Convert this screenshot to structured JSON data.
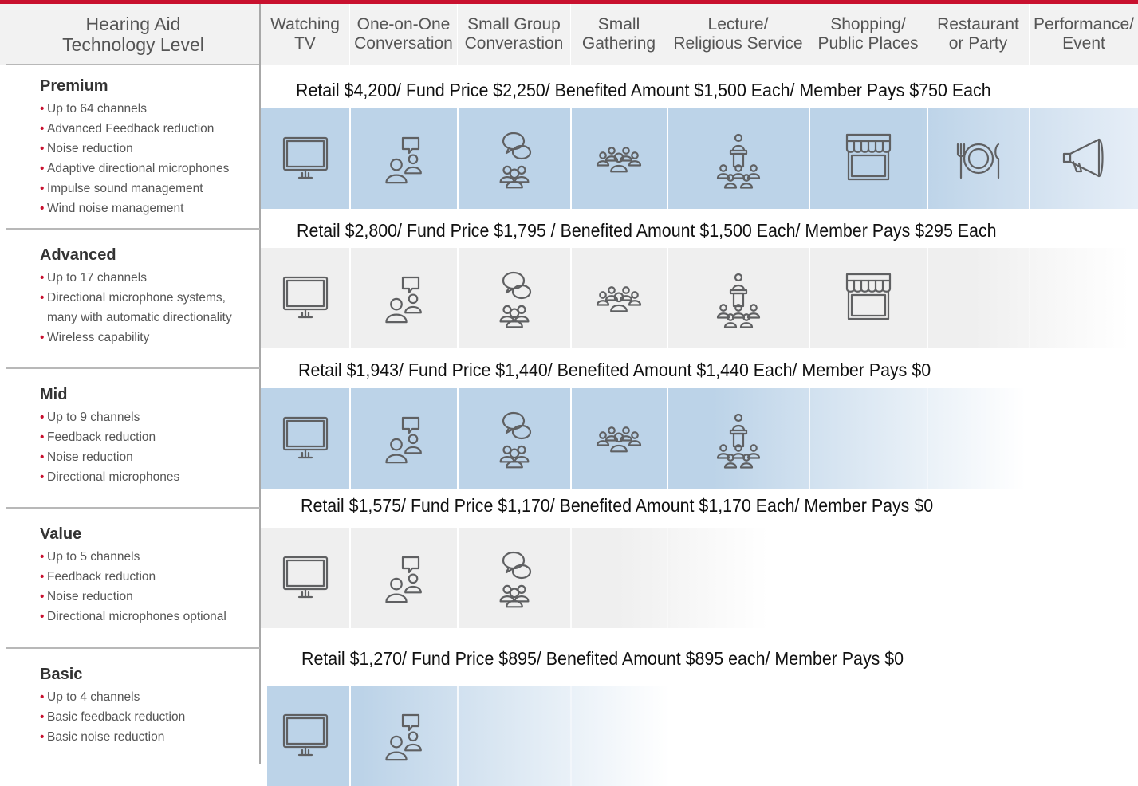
{
  "header": {
    "title": "Hearing Aid\nTechnology Level",
    "columns": [
      {
        "label": "Watching\nTV"
      },
      {
        "label": "One-on-One\nConversation"
      },
      {
        "label": "Small Group\nConverastion"
      },
      {
        "label": "Small\nGathering"
      },
      {
        "label": "Lecture/\nReligious Service"
      },
      {
        "label": "Shopping/\nPublic Places"
      },
      {
        "label": "Restaurant\nor Party"
      },
      {
        "label": "Performance/\nEvent"
      }
    ]
  },
  "column_icons": [
    "tv-icon",
    "conversation-icon",
    "group-chat-icon",
    "crowd-icon",
    "lecture-icon",
    "store-icon",
    "dining-icon",
    "megaphone-icon"
  ],
  "tiers": [
    {
      "name": "Premium",
      "features": [
        "Up to 64 channels",
        "Advanced Feedback reduction",
        "Noise reduction",
        "Adaptive directional microphones",
        "Impulse sound management",
        "Wind noise management"
      ],
      "price": "Retail $4,200/ Fund Price $2,250/ Benefited Amount $1,500 Each/ Member Pays $750 Each",
      "supported_count": 8,
      "band_color": "blue"
    },
    {
      "name": "Advanced",
      "features": [
        "Up to 17 channels",
        "Directional microphone systems,",
        "many with automatic directionality",
        "Wireless capability"
      ],
      "price": "Retail $2,800/ Fund Price $1,795 / Benefited Amount $1,500 Each/ Member Pays $295 Each",
      "supported_count": 6,
      "band_color": "gray"
    },
    {
      "name": "Mid",
      "features": [
        "Up to 9 channels",
        "Feedback reduction",
        "Noise reduction",
        "Directional microphones"
      ],
      "price": "Retail $1,943/ Fund Price $1,440/ Benefited Amount  $1,440 Each/ Member Pays $0",
      "supported_count": 5,
      "band_color": "blue"
    },
    {
      "name": "Value",
      "features": [
        "Up to 5 channels",
        "Feedback reduction",
        "Noise reduction",
        "Directional microphones optional"
      ],
      "price": "Retail $1,575/ Fund Price $1,170/ Benefited Amount $1,170 Each/ Member Pays $0",
      "supported_count": 3,
      "band_color": "gray"
    },
    {
      "name": "Basic",
      "features": [
        "Up to 4 channels",
        "Basic feedback reduction",
        "Basic noise reduction"
      ],
      "price": "Retail $1,270/ Fund Price $895/ Benefited Amount $895 each/ Member Pays $0",
      "supported_count": 2,
      "band_color": "blue"
    }
  ],
  "colors": {
    "accent": "#c8102e",
    "blue_band": "#bcd3e8",
    "gray_band": "#efefef",
    "icon_stroke": "#5f6062"
  }
}
